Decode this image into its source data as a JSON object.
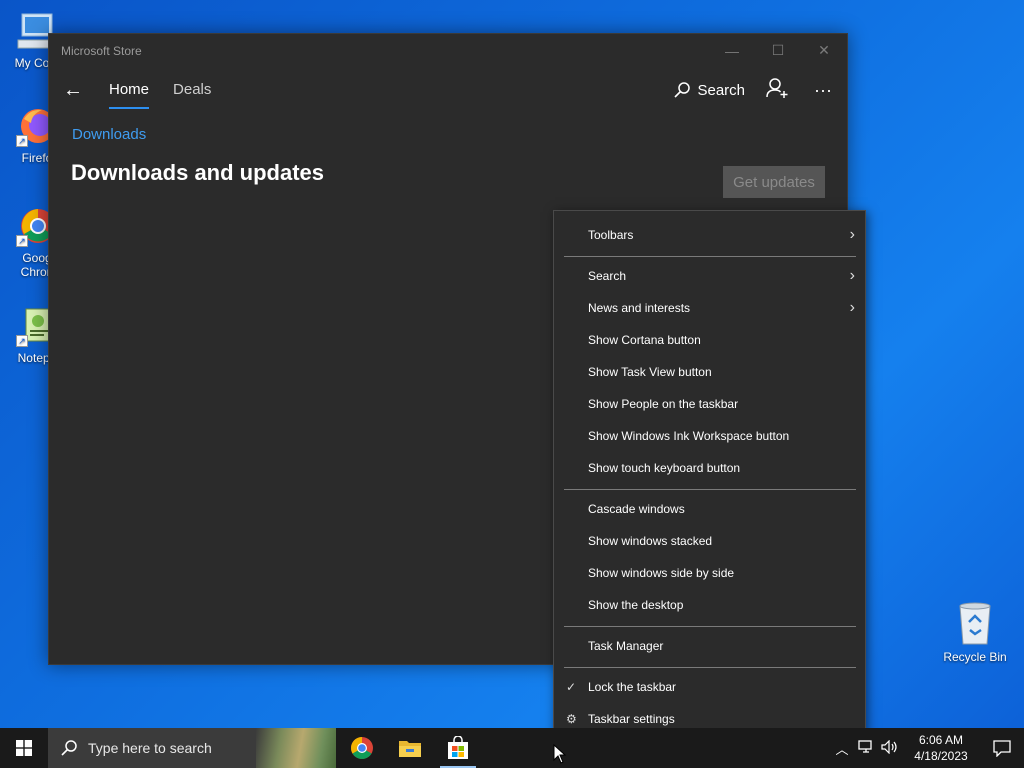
{
  "desktop": {
    "icons": [
      {
        "name": "my-computer",
        "label": "My Com"
      },
      {
        "name": "firefox",
        "label": "Firefo"
      },
      {
        "name": "chrome",
        "label1": "Goog",
        "label2": "Chron"
      },
      {
        "name": "notepad",
        "label": "Notepa"
      }
    ],
    "recycle_bin": "Recycle Bin"
  },
  "window": {
    "title": "Microsoft Store",
    "nav": {
      "home": "Home",
      "deals": "Deals",
      "search": "Search"
    },
    "breadcrumb": "Downloads",
    "page_title": "Downloads and updates",
    "get_updates": "Get updates"
  },
  "context_menu": {
    "items": [
      {
        "label": "Toolbars",
        "arrow": "›"
      },
      {
        "label": "Search",
        "arrow": "›"
      },
      {
        "label": "News and interests",
        "arrow": "›"
      },
      {
        "label": "Show Cortana button"
      },
      {
        "label": "Show Task View button"
      },
      {
        "label": "Show People on the taskbar"
      },
      {
        "label": "Show Windows Ink Workspace button"
      },
      {
        "label": "Show touch keyboard button"
      },
      {
        "label": "Cascade windows"
      },
      {
        "label": "Show windows stacked"
      },
      {
        "label": "Show windows side by side"
      },
      {
        "label": "Show the desktop"
      },
      {
        "label": "Task Manager"
      },
      {
        "label": "Lock the taskbar",
        "checked": true
      },
      {
        "label": "Taskbar settings",
        "icon": "gear-icon"
      }
    ]
  },
  "taskbar": {
    "search_placeholder": "Type here to search",
    "time": "6:06 AM",
    "date": "4/18/2023"
  },
  "colors": {
    "accent": "#2d8ff0",
    "link": "#3f9cf0",
    "window_bg": "#2b2b2b",
    "taskbar_bg": "#1a1a1a"
  }
}
